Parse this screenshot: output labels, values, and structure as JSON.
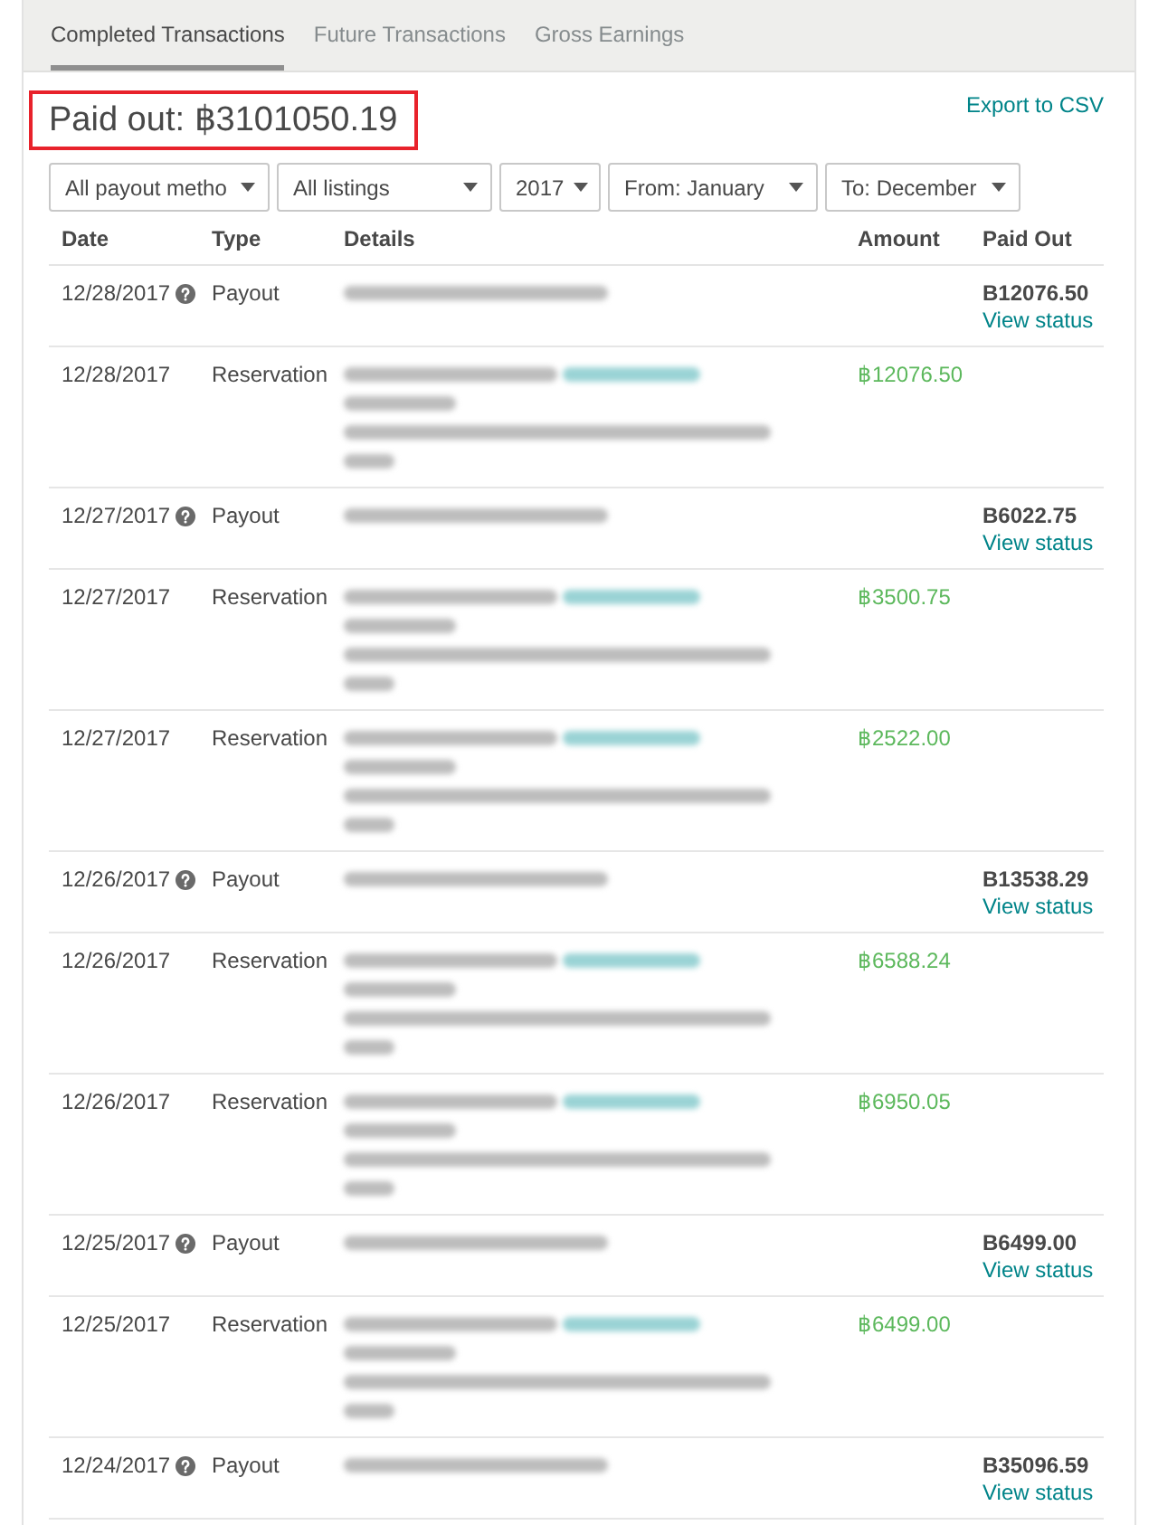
{
  "tabs": [
    {
      "label": "Completed Transactions",
      "selected": true
    },
    {
      "label": "Future Transactions",
      "selected": false
    },
    {
      "label": "Gross Earnings",
      "selected": false
    }
  ],
  "summary": {
    "label": "Paid out: ฿3101050.19",
    "highlighted": true
  },
  "export_link": "Export to CSV",
  "filters": [
    {
      "value": "All payout metho"
    },
    {
      "value": "All listings"
    },
    {
      "value": "2017"
    },
    {
      "value": "From: January"
    },
    {
      "value": "To: December"
    }
  ],
  "table": {
    "columns": [
      "Date",
      "Type",
      "Details",
      "Amount",
      "Paid Out"
    ],
    "rows": [
      {
        "kind": "payout",
        "date": "12/28/2017",
        "type": "Payout",
        "paid_out": "B12076.50",
        "status_link": "View status"
      },
      {
        "kind": "reservation",
        "date": "12/28/2017",
        "type": "Reservation",
        "amount": "฿12076.50"
      },
      {
        "kind": "payout",
        "date": "12/27/2017",
        "type": "Payout",
        "paid_out": "B6022.75",
        "status_link": "View status"
      },
      {
        "kind": "reservation",
        "date": "12/27/2017",
        "type": "Reservation",
        "amount": "฿3500.75"
      },
      {
        "kind": "reservation",
        "date": "12/27/2017",
        "type": "Reservation",
        "amount": "฿2522.00"
      },
      {
        "kind": "payout",
        "date": "12/26/2017",
        "type": "Payout",
        "paid_out": "B13538.29",
        "status_link": "View status"
      },
      {
        "kind": "reservation",
        "date": "12/26/2017",
        "type": "Reservation",
        "amount": "฿6588.24"
      },
      {
        "kind": "reservation",
        "date": "12/26/2017",
        "type": "Reservation",
        "amount": "฿6950.05"
      },
      {
        "kind": "payout",
        "date": "12/25/2017",
        "type": "Payout",
        "paid_out": "B6499.00",
        "status_link": "View status"
      },
      {
        "kind": "reservation",
        "date": "12/25/2017",
        "type": "Reservation",
        "amount": "฿6499.00"
      },
      {
        "kind": "payout",
        "date": "12/24/2017",
        "type": "Payout",
        "paid_out": "B35096.59",
        "status_link": "View status"
      }
    ]
  }
}
